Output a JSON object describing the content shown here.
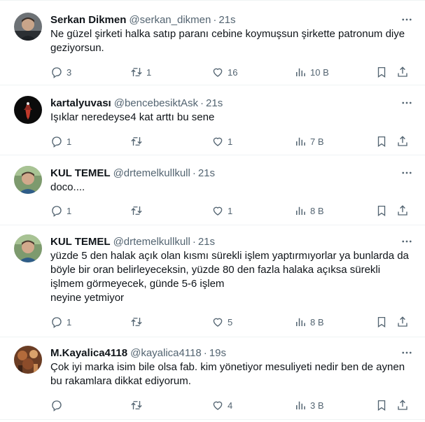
{
  "tweets": [
    {
      "name": "Serkan Dikmen",
      "handle": "@serkan_dikmen",
      "time": "21s",
      "text": "Ne güzel şirketi halka satıp paranı cebine koymuşsun şirkette patronum diye geziyorsun.",
      "replies": "3",
      "retweets": "1",
      "likes": "16",
      "views": "10 B",
      "avatar_color": "#5b5f63"
    },
    {
      "name": "kartalyuvası",
      "handle": "@bencebesiktAsk",
      "time": "21s",
      "text": "Işıklar neredeyse4 kat arttı bu sene",
      "replies": "1",
      "retweets": "",
      "likes": "1",
      "views": "7 B",
      "avatar_color": "#0b0b0b"
    },
    {
      "name": "KUL TEMEL",
      "handle": "@drtemelkullkull",
      "time": "21s",
      "text": "doco....",
      "replies": "1",
      "retweets": "",
      "likes": "1",
      "views": "8 B",
      "avatar_color": "#5c7b54"
    },
    {
      "name": "KUL TEMEL",
      "handle": "@drtemelkullkull",
      "time": "21s",
      "text": "yüzde 5 den halak açık olan kısmı sürekli işlem yaptırmıyorlar ya bunlarda da böyle bir oran belirleyeceksin, yüzde 80 den fazla halaka açıksa sürekli işlmem görmeyecek, günde 5-6 işlem\nneyine yetmiyor",
      "replies": "1",
      "retweets": "",
      "likes": "5",
      "views": "8 B",
      "avatar_color": "#5c7b54"
    },
    {
      "name": "M.Kayalica4118",
      "handle": "@kayalica4118",
      "time": "19s",
      "text": "Çok iyi marka isim bile olsa fab. kim yönetiyor mesuliyeti nedir ben de aynen bu rakamlara dikkat ediyorum.",
      "replies": "",
      "retweets": "",
      "likes": "4",
      "views": "3 B",
      "avatar_color": "#7a4a2c"
    }
  ],
  "colors": {
    "text": "#0f1419",
    "secondary": "#536471",
    "divider": "#eff3f4"
  }
}
